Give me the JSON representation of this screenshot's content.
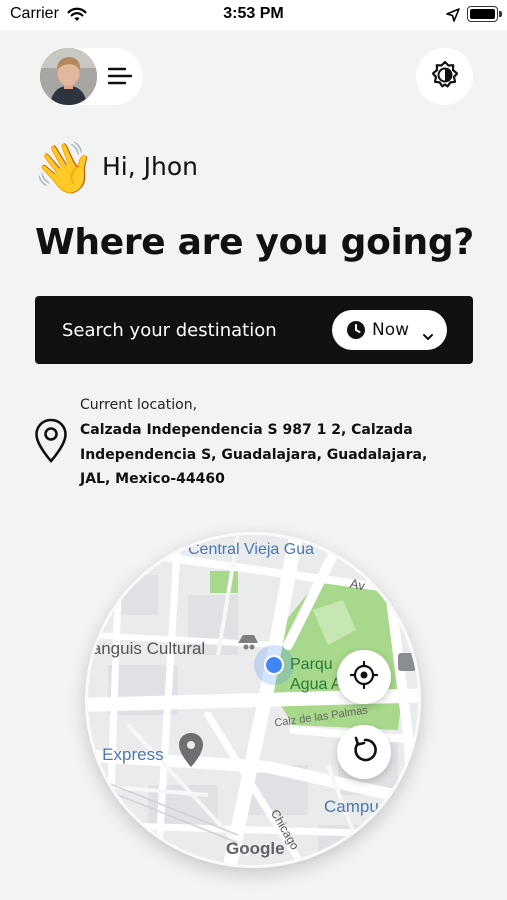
{
  "status_bar": {
    "carrier": "Carrier",
    "time": "3:53 PM"
  },
  "header": {
    "avatar_icon": "user-avatar",
    "menu_icon": "menu-icon",
    "theme_icon": "theme-toggle-icon"
  },
  "greeting": {
    "emoji": "👋",
    "text": "Hi, Jhon"
  },
  "headline": "Where are you going?",
  "search": {
    "placeholder": "Search your destination",
    "time_option": "Now",
    "time_icon": "clock-icon",
    "dropdown_icon": "chevron-down-icon"
  },
  "current_location": {
    "caption": "Current location,",
    "address": "Calzada Independencia S 987 1 2, Calzada Independencia S, Guadalajara, Guadalajara, JAL, Mexico-44460"
  },
  "map": {
    "labels": {
      "central": "Central Vieja Gua",
      "tianguis": "ianguis Cultural",
      "parque_line1": "Parqu",
      "parque_line2": "Agua A",
      "calzada": "Calz de las Palmas",
      "express": "o Express",
      "campus": "Campu",
      "chicago": "Chicago",
      "avenue": "Av",
      "attribution": "Google"
    },
    "controls": {
      "locate_icon": "crosshair-icon",
      "refresh_icon": "refresh-icon"
    },
    "colors": {
      "park": "#a8d88c",
      "road": "#ffffff",
      "block": "#e3e5e7",
      "user_dot": "#4285f4"
    }
  },
  "colors": {
    "background": "#f3f3f3",
    "search_bar": "#111111",
    "surface": "#ffffff"
  }
}
